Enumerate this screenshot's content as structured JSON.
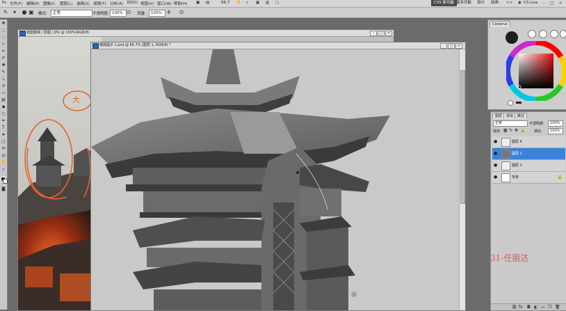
{
  "menubar": {
    "menus": [
      "文件(F)",
      "编辑(E)",
      "图像(I)",
      "图层(L)",
      "选择(S)",
      "滤镜(T)",
      "分析(A)",
      "3D(D)",
      "视图(V)",
      "窗口(W)",
      "帮助(H)"
    ],
    "zoom": "66.7",
    "workspace_buttons": [
      "CS5 新功能",
      "基本功能",
      "设计",
      "绘画"
    ],
    "more": ">>",
    "cslive": "CS Live",
    "window_controls": [
      "–",
      "□",
      "×"
    ]
  },
  "options": {
    "mode_label": "模式:",
    "mode_value": "正常",
    "opacity_label": "不透明度:",
    "opacity_value": "100%",
    "flow_label": "流量:",
    "flow_value": "100%"
  },
  "doc_back": {
    "title": "城堡鹏喻 / 原图 / JPG @ 100%(RGB/8)"
  },
  "doc_front": {
    "title": "楼阁提示 1.psd @ 66.7% (图层 1, RGB/8) *",
    "annotation": "大"
  },
  "color_panel": {
    "tab": "Coolorus"
  },
  "layers_panel": {
    "tabs": [
      "图层",
      "通道",
      "路径"
    ],
    "blend_mode": "正常",
    "opacity_label": "不透明度:",
    "opacity_value": "100%",
    "lock_label": "锁定:",
    "fill_label": "填充:",
    "fill_value": "100%",
    "layers": [
      {
        "name": "图层 4",
        "selected": false,
        "locked": false
      },
      {
        "name": "图层 1",
        "selected": true,
        "locked": false
      },
      {
        "name": "图层 3",
        "selected": false,
        "locked": false
      },
      {
        "name": "背景",
        "selected": false,
        "locked": true
      }
    ]
  },
  "watermark": "31-任丽达",
  "colors": {
    "menubar_bg": "#d6d6d6",
    "selection_blue": "#3b83d8",
    "annotation_orange": "#e8622a",
    "watermark_red": "#d65b55"
  }
}
